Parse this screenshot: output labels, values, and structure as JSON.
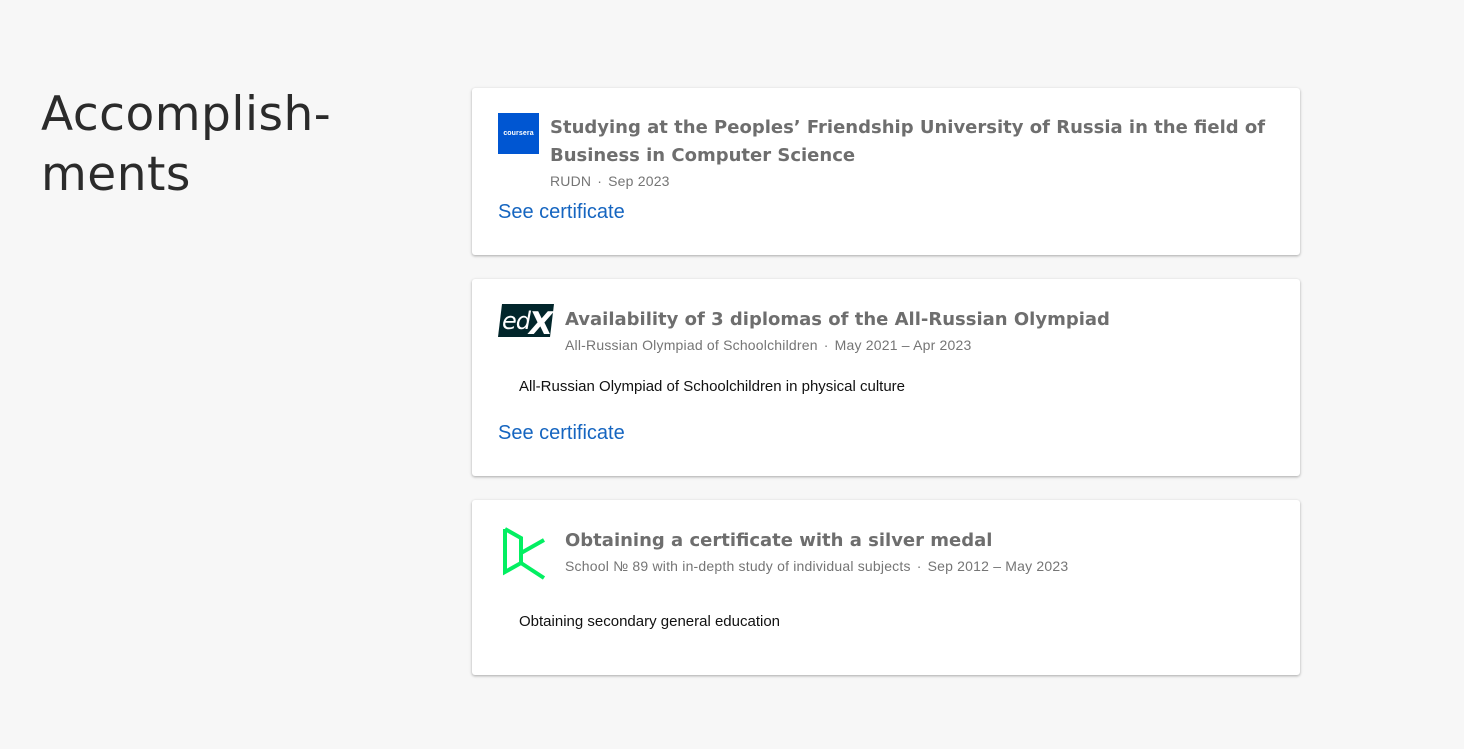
{
  "section": {
    "title_line1": "Accomplish-",
    "title_line2": "ments"
  },
  "accomplishments": [
    {
      "logo": {
        "name": "coursera-logo",
        "text": "coursera",
        "color": "#0056d2"
      },
      "title": "Studying at the Peoples’ Friendship University of Russia in the field of Business in Computer Science",
      "organization": "RUDN",
      "date": "Sep 2023",
      "description": "",
      "link_label": "See certificate"
    },
    {
      "logo": {
        "name": "edx-logo",
        "text": "edX",
        "color": "#02262b"
      },
      "title": "Availability of 3 diplomas of the All-Russian Olympiad",
      "organization": "All-Russian Olympiad of Schoolchildren",
      "date": "May 2021 – Apr 2023",
      "description": "All-Russian Olympiad of Schoolchildren in physical culture",
      "link_label": "See certificate"
    },
    {
      "logo": {
        "name": "datacamp-logo",
        "color": "#03ef62"
      },
      "title": "Obtaining a certificate with a silver medal",
      "organization": "School № 89 with in-depth study of individual subjects",
      "date": "Sep 2012 – May 2023",
      "description": "Obtaining secondary general education",
      "link_label": ""
    }
  ],
  "separator": "·",
  "colors": {
    "background": "#f7f7f7",
    "card": "#ffffff",
    "title": "#6e6e6e",
    "meta": "#757575",
    "link": "#1565c0"
  }
}
